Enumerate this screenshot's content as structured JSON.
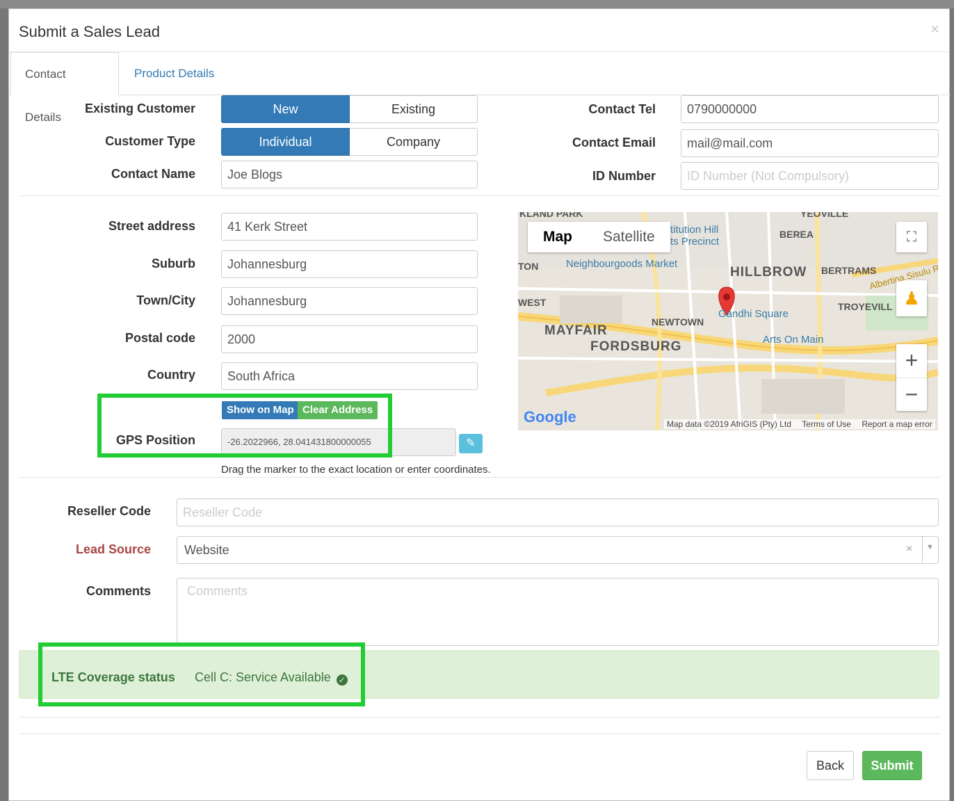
{
  "modal": {
    "title": "Submit a Sales Lead",
    "close_label": "×"
  },
  "tabs": [
    {
      "label": "Contact Details",
      "active": true
    },
    {
      "label": "Product Details",
      "active": false
    }
  ],
  "contact": {
    "existing_customer": {
      "label": "Existing Customer",
      "options": [
        "New",
        "Existing"
      ],
      "selected": "New"
    },
    "customer_type": {
      "label": "Customer Type",
      "options": [
        "Individual",
        "Company"
      ],
      "selected": "Individual"
    },
    "contact_name": {
      "label": "Contact Name",
      "value": "Joe Blogs"
    },
    "contact_tel": {
      "label": "Contact Tel",
      "value": "0790000000"
    },
    "contact_email": {
      "label": "Contact Email",
      "value": "mail@mail.com"
    },
    "id_number": {
      "label": "ID Number",
      "placeholder": "ID Number (Not Compulsory)"
    }
  },
  "address": {
    "street": {
      "label": "Street address",
      "value": "41 Kerk Street"
    },
    "suburb": {
      "label": "Suburb",
      "value": "Johannesburg"
    },
    "town": {
      "label": "Town/City",
      "value": "Johannesburg"
    },
    "postal": {
      "label": "Postal code",
      "value": "2000"
    },
    "country": {
      "label": "Country",
      "value": "South Africa"
    },
    "show_on_map": "Show on Map",
    "clear_address": "Clear Address",
    "gps": {
      "label": "GPS Position",
      "value": "-26.2022966, 28.041431800000055"
    },
    "help": "Drag the marker to the exact location or enter coordinates."
  },
  "map": {
    "type_options": [
      "Map",
      "Satellite"
    ],
    "selected_type": "Map",
    "labels": {
      "hillbrow": "HILLBROW",
      "bertrams": "BERTRAMS",
      "berea": "BEREA",
      "yeoville": "YEOVILLE",
      "troyeville": "TROYEVILL",
      "mayfair": "MAYFAIR",
      "fordsburg": "FORDSBURG",
      "newtown": "NEWTOWN",
      "gandhi": "Gandhi Square",
      "arts": "Arts On Main",
      "neighbourgoods": "Neighbourgoods Market",
      "constitution": "titution Hill",
      "precinct": "ts Precinct",
      "kland": "KLAND PARK",
      "ton": "TON",
      "west": "WEST",
      "albertina": "Albertina Sisulu R"
    },
    "google": "Google",
    "footer": {
      "data": "Map data ©2019 AfriGIS (Pty) Ltd",
      "terms": "Terms of Use",
      "report": "Report a map error"
    },
    "zoom_in": "+",
    "zoom_out": "−"
  },
  "extra": {
    "reseller": {
      "label": "Reseller Code",
      "placeholder": "Reseller Code"
    },
    "lead_source": {
      "label": "Lead Source",
      "value": "Website"
    },
    "comments": {
      "label": "Comments",
      "placeholder": "Comments"
    }
  },
  "coverage": {
    "label": "LTE Coverage status",
    "value": "Cell C: Service Available"
  },
  "footer": {
    "back": "Back",
    "submit": "Submit"
  },
  "colors": {
    "primary": "#337ab7",
    "success": "#5cb85c",
    "info": "#5bc0de",
    "lead_source_label": "#a94442",
    "alert_bg": "#dff0d8",
    "alert_text": "#3c763d",
    "highlight": "#22cc33"
  }
}
